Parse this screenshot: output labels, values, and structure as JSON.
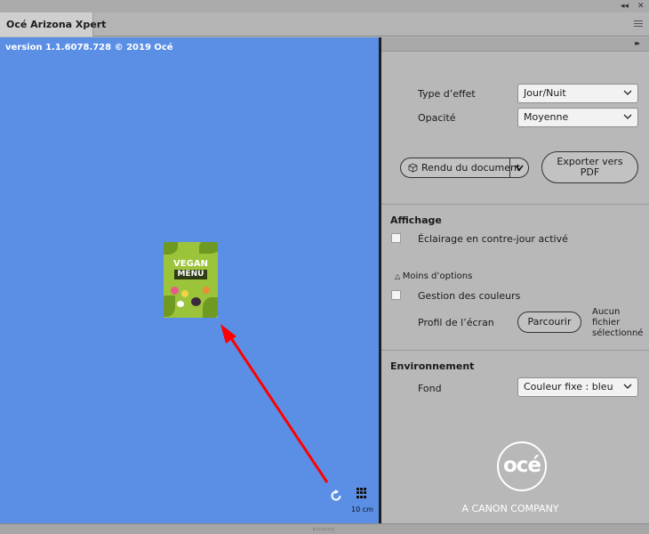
{
  "window": {
    "tab_title": "Océ Arizona Xpert",
    "controls": {
      "collapse_icon": "double-left-arrow-icon",
      "close_icon": "close-icon",
      "menu_icon": "hamburger-menu-icon"
    }
  },
  "canvas": {
    "version_text": "version 1.1.6078.728 © 2019 Océ",
    "background_color": "#5b8fe6",
    "document_preview": {
      "headline": "VEGAN",
      "subline": "MENU",
      "background_color": "#9cc43a"
    },
    "scale_label": "10 cm",
    "annotation_arrow_color": "#ff0000"
  },
  "panel": {
    "type_effet": {
      "label": "Type d’effet",
      "value": "Jour/Nuit"
    },
    "opacite": {
      "label": "Opacité",
      "value": "Moyenne"
    },
    "render_button": {
      "label": "Rendu du document"
    },
    "export_button": {
      "line1": "Exporter vers",
      "line2": "PDF"
    },
    "affichage": {
      "title": "Affichage",
      "backlight_label": "Éclairage en contre-jour activé",
      "backlight_checked": false,
      "fewer_options": "Moins d’options",
      "color_mgmt_label": "Gestion des couleurs",
      "color_mgmt_checked": false,
      "screen_profile_label": "Profil de l’écran",
      "browse_button": "Parcourir",
      "no_file": [
        "Aucun",
        "fichier",
        "sélectionné"
      ]
    },
    "environnement": {
      "title": "Environnement",
      "fond_label": "Fond",
      "fond_value": "Couleur fixe : bleu"
    },
    "logo": {
      "brand": "océ",
      "tagline": "A CANON COMPANY"
    }
  }
}
